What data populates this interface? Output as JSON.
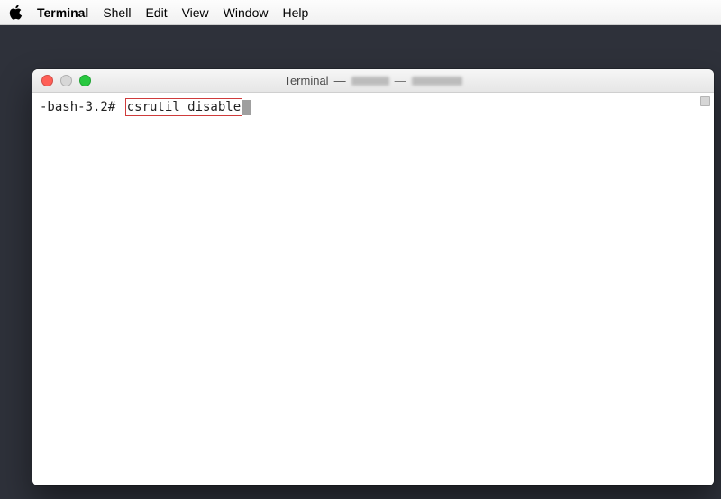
{
  "menubar": {
    "app_name": "Terminal",
    "items": [
      "Shell",
      "Edit",
      "View",
      "Window",
      "Help"
    ]
  },
  "window": {
    "title_prefix": "Terminal",
    "title_separator": "—",
    "title_dash": "—"
  },
  "terminal": {
    "prompt": "-bash-3.2# ",
    "command": "csrutil disable"
  }
}
